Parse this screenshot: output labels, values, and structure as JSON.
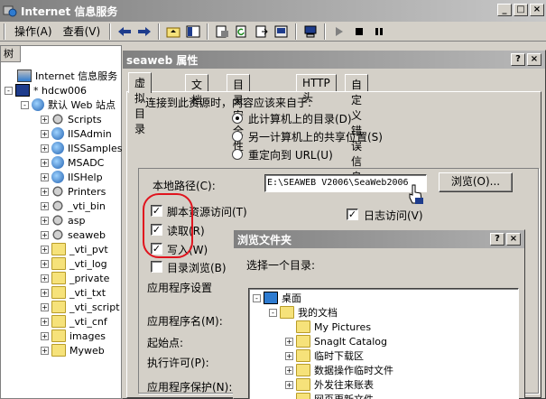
{
  "window": {
    "title": "Internet 信息服务"
  },
  "menu": {
    "action": "操作(A)",
    "view": "查看(V)"
  },
  "left_pane": {
    "tab_label": "树",
    "tree": [
      {
        "label": "Internet 信息服务",
        "level": 0,
        "icon": "iis-icon"
      },
      {
        "label": "* hdcw006",
        "level": 1,
        "icon": "computer-icon",
        "expander": "-"
      },
      {
        "label": "默认 Web 站点",
        "level": 2,
        "icon": "web-site-icon",
        "expander": "-"
      },
      {
        "label": "Scripts",
        "level": 3,
        "icon": "gear-icon",
        "expander": "+"
      },
      {
        "label": "IISAdmin",
        "level": 3,
        "icon": "globe-icon",
        "expander": "+"
      },
      {
        "label": "IISSamples",
        "level": 3,
        "icon": "globe-icon",
        "expander": "+"
      },
      {
        "label": "MSADC",
        "level": 3,
        "icon": "globe-icon",
        "expander": "+"
      },
      {
        "label": "IISHelp",
        "level": 3,
        "icon": "globe-icon",
        "expander": "+"
      },
      {
        "label": "Printers",
        "level": 3,
        "icon": "gear-icon",
        "expander": "+"
      },
      {
        "label": "_vti_bin",
        "level": 3,
        "icon": "gear-icon",
        "expander": "+"
      },
      {
        "label": "asp",
        "level": 3,
        "icon": "gear-icon",
        "expander": "+"
      },
      {
        "label": "seaweb",
        "level": 3,
        "icon": "gear-icon",
        "expander": "+"
      },
      {
        "label": "_vti_pvt",
        "level": 3,
        "icon": "folder-icon",
        "expander": "+"
      },
      {
        "label": "_vti_log",
        "level": 3,
        "icon": "folder-icon",
        "expander": "+"
      },
      {
        "label": "_private",
        "level": 3,
        "icon": "folder-icon",
        "expander": "+"
      },
      {
        "label": "_vti_txt",
        "level": 3,
        "icon": "folder-icon",
        "expander": "+"
      },
      {
        "label": "_vti_script",
        "level": 3,
        "icon": "folder-icon",
        "expander": "+"
      },
      {
        "label": "_vti_cnf",
        "level": 3,
        "icon": "folder-icon",
        "expander": "+"
      },
      {
        "label": "images",
        "level": 3,
        "icon": "folder-icon",
        "expander": "+"
      },
      {
        "label": "Myweb",
        "level": 3,
        "icon": "folder-icon",
        "expander": "+"
      }
    ]
  },
  "properties_dialog": {
    "title": "seaweb 属性",
    "tabs": [
      {
        "label": "虚拟目录",
        "active": true
      },
      {
        "label": "文档",
        "active": false
      },
      {
        "label": "目录安全性",
        "active": false
      },
      {
        "label": "HTTP 头",
        "active": false
      },
      {
        "label": "自定义错误信息",
        "active": false
      }
    ],
    "connect_label": "连接到此资源时，内容应该来自于:",
    "source_options": [
      {
        "label": "此计算机上的目录(D)",
        "selected": true
      },
      {
        "label": "另一计算机上的共享位置(S)",
        "selected": false
      },
      {
        "label": "重定向到 URL(U)",
        "selected": false
      }
    ],
    "local_path_label": "本地路径(C):",
    "local_path_value": "E:\\SEAWEB V2006\\SeaWeb2006",
    "browse_button": "浏览(O)...",
    "checkboxes": [
      {
        "label": "脚本资源访问(T)",
        "checked": true
      },
      {
        "label": "读取(R)",
        "checked": true
      },
      {
        "label": "写入(W)",
        "checked": true
      },
      {
        "label": "目录浏览(B)",
        "checked": false
      }
    ],
    "log_access": {
      "label": "日志访问(V)",
      "checked": true
    },
    "app_settings_label": "应用程序设置",
    "app_name_label": "应用程序名(M):",
    "start_point_label": "起始点:",
    "exec_permission_label": "执行许可(P):",
    "app_protection_label": "应用程序保护(N):"
  },
  "browse_dialog": {
    "title": "浏览文件夹",
    "prompt": "选择一个目录:",
    "tree": [
      {
        "label": "桌面",
        "icon": "desktop-icon",
        "expander": "-"
      },
      {
        "label": "我的文档",
        "icon": "my-documents-icon",
        "expander": "-"
      },
      {
        "label": "My Pictures",
        "icon": "pictures-folder-icon",
        "expander": ""
      },
      {
        "label": "SnagIt Catalog",
        "icon": "folder-icon",
        "expander": "+"
      },
      {
        "label": "临时下载区",
        "icon": "folder-icon",
        "expander": "+"
      },
      {
        "label": "数据操作临时文件",
        "icon": "folder-icon",
        "expander": "+"
      },
      {
        "label": "外发往来账表",
        "icon": "folder-icon",
        "expander": "+"
      },
      {
        "label": "网页更新文件",
        "icon": "folder-icon",
        "expander": ""
      }
    ]
  },
  "annotation_color": "#e0141e"
}
